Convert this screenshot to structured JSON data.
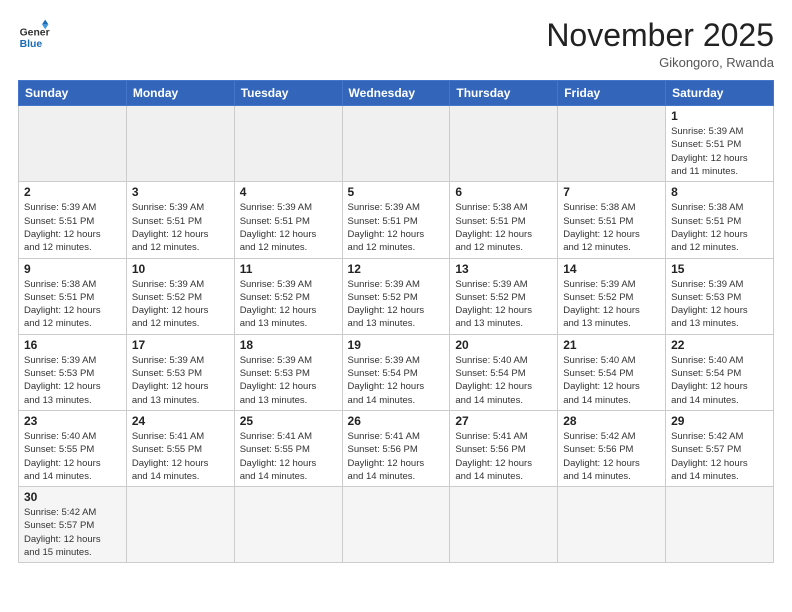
{
  "logo": {
    "line1": "General",
    "line2": "Blue"
  },
  "title": "November 2025",
  "subtitle": "Gikongoro, Rwanda",
  "days_header": [
    "Sunday",
    "Monday",
    "Tuesday",
    "Wednesday",
    "Thursday",
    "Friday",
    "Saturday"
  ],
  "weeks": [
    [
      {
        "day": "",
        "info": "",
        "empty": true
      },
      {
        "day": "",
        "info": "",
        "empty": true
      },
      {
        "day": "",
        "info": "",
        "empty": true
      },
      {
        "day": "",
        "info": "",
        "empty": true
      },
      {
        "day": "",
        "info": "",
        "empty": true
      },
      {
        "day": "",
        "info": "",
        "empty": true
      },
      {
        "day": "1",
        "info": "Sunrise: 5:39 AM\nSunset: 5:51 PM\nDaylight: 12 hours\nand 11 minutes."
      }
    ],
    [
      {
        "day": "2",
        "info": "Sunrise: 5:39 AM\nSunset: 5:51 PM\nDaylight: 12 hours\nand 12 minutes."
      },
      {
        "day": "3",
        "info": "Sunrise: 5:39 AM\nSunset: 5:51 PM\nDaylight: 12 hours\nand 12 minutes."
      },
      {
        "day": "4",
        "info": "Sunrise: 5:39 AM\nSunset: 5:51 PM\nDaylight: 12 hours\nand 12 minutes."
      },
      {
        "day": "5",
        "info": "Sunrise: 5:39 AM\nSunset: 5:51 PM\nDaylight: 12 hours\nand 12 minutes."
      },
      {
        "day": "6",
        "info": "Sunrise: 5:38 AM\nSunset: 5:51 PM\nDaylight: 12 hours\nand 12 minutes."
      },
      {
        "day": "7",
        "info": "Sunrise: 5:38 AM\nSunset: 5:51 PM\nDaylight: 12 hours\nand 12 minutes."
      },
      {
        "day": "8",
        "info": "Sunrise: 5:38 AM\nSunset: 5:51 PM\nDaylight: 12 hours\nand 12 minutes."
      }
    ],
    [
      {
        "day": "9",
        "info": "Sunrise: 5:38 AM\nSunset: 5:51 PM\nDaylight: 12 hours\nand 12 minutes."
      },
      {
        "day": "10",
        "info": "Sunrise: 5:39 AM\nSunset: 5:52 PM\nDaylight: 12 hours\nand 12 minutes."
      },
      {
        "day": "11",
        "info": "Sunrise: 5:39 AM\nSunset: 5:52 PM\nDaylight: 12 hours\nand 13 minutes."
      },
      {
        "day": "12",
        "info": "Sunrise: 5:39 AM\nSunset: 5:52 PM\nDaylight: 12 hours\nand 13 minutes."
      },
      {
        "day": "13",
        "info": "Sunrise: 5:39 AM\nSunset: 5:52 PM\nDaylight: 12 hours\nand 13 minutes."
      },
      {
        "day": "14",
        "info": "Sunrise: 5:39 AM\nSunset: 5:52 PM\nDaylight: 12 hours\nand 13 minutes."
      },
      {
        "day": "15",
        "info": "Sunrise: 5:39 AM\nSunset: 5:53 PM\nDaylight: 12 hours\nand 13 minutes."
      }
    ],
    [
      {
        "day": "16",
        "info": "Sunrise: 5:39 AM\nSunset: 5:53 PM\nDaylight: 12 hours\nand 13 minutes."
      },
      {
        "day": "17",
        "info": "Sunrise: 5:39 AM\nSunset: 5:53 PM\nDaylight: 12 hours\nand 13 minutes."
      },
      {
        "day": "18",
        "info": "Sunrise: 5:39 AM\nSunset: 5:53 PM\nDaylight: 12 hours\nand 13 minutes."
      },
      {
        "day": "19",
        "info": "Sunrise: 5:39 AM\nSunset: 5:54 PM\nDaylight: 12 hours\nand 14 minutes."
      },
      {
        "day": "20",
        "info": "Sunrise: 5:40 AM\nSunset: 5:54 PM\nDaylight: 12 hours\nand 14 minutes."
      },
      {
        "day": "21",
        "info": "Sunrise: 5:40 AM\nSunset: 5:54 PM\nDaylight: 12 hours\nand 14 minutes."
      },
      {
        "day": "22",
        "info": "Sunrise: 5:40 AM\nSunset: 5:54 PM\nDaylight: 12 hours\nand 14 minutes."
      }
    ],
    [
      {
        "day": "23",
        "info": "Sunrise: 5:40 AM\nSunset: 5:55 PM\nDaylight: 12 hours\nand 14 minutes."
      },
      {
        "day": "24",
        "info": "Sunrise: 5:41 AM\nSunset: 5:55 PM\nDaylight: 12 hours\nand 14 minutes."
      },
      {
        "day": "25",
        "info": "Sunrise: 5:41 AM\nSunset: 5:55 PM\nDaylight: 12 hours\nand 14 minutes."
      },
      {
        "day": "26",
        "info": "Sunrise: 5:41 AM\nSunset: 5:56 PM\nDaylight: 12 hours\nand 14 minutes."
      },
      {
        "day": "27",
        "info": "Sunrise: 5:41 AM\nSunset: 5:56 PM\nDaylight: 12 hours\nand 14 minutes."
      },
      {
        "day": "28",
        "info": "Sunrise: 5:42 AM\nSunset: 5:56 PM\nDaylight: 12 hours\nand 14 minutes."
      },
      {
        "day": "29",
        "info": "Sunrise: 5:42 AM\nSunset: 5:57 PM\nDaylight: 12 hours\nand 14 minutes."
      }
    ],
    [
      {
        "day": "30",
        "info": "Sunrise: 5:42 AM\nSunset: 5:57 PM\nDaylight: 12 hours\nand 15 minutes."
      },
      {
        "day": "",
        "info": "",
        "empty": true
      },
      {
        "day": "",
        "info": "",
        "empty": true
      },
      {
        "day": "",
        "info": "",
        "empty": true
      },
      {
        "day": "",
        "info": "",
        "empty": true
      },
      {
        "day": "",
        "info": "",
        "empty": true
      },
      {
        "day": "",
        "info": "",
        "empty": true
      }
    ]
  ]
}
